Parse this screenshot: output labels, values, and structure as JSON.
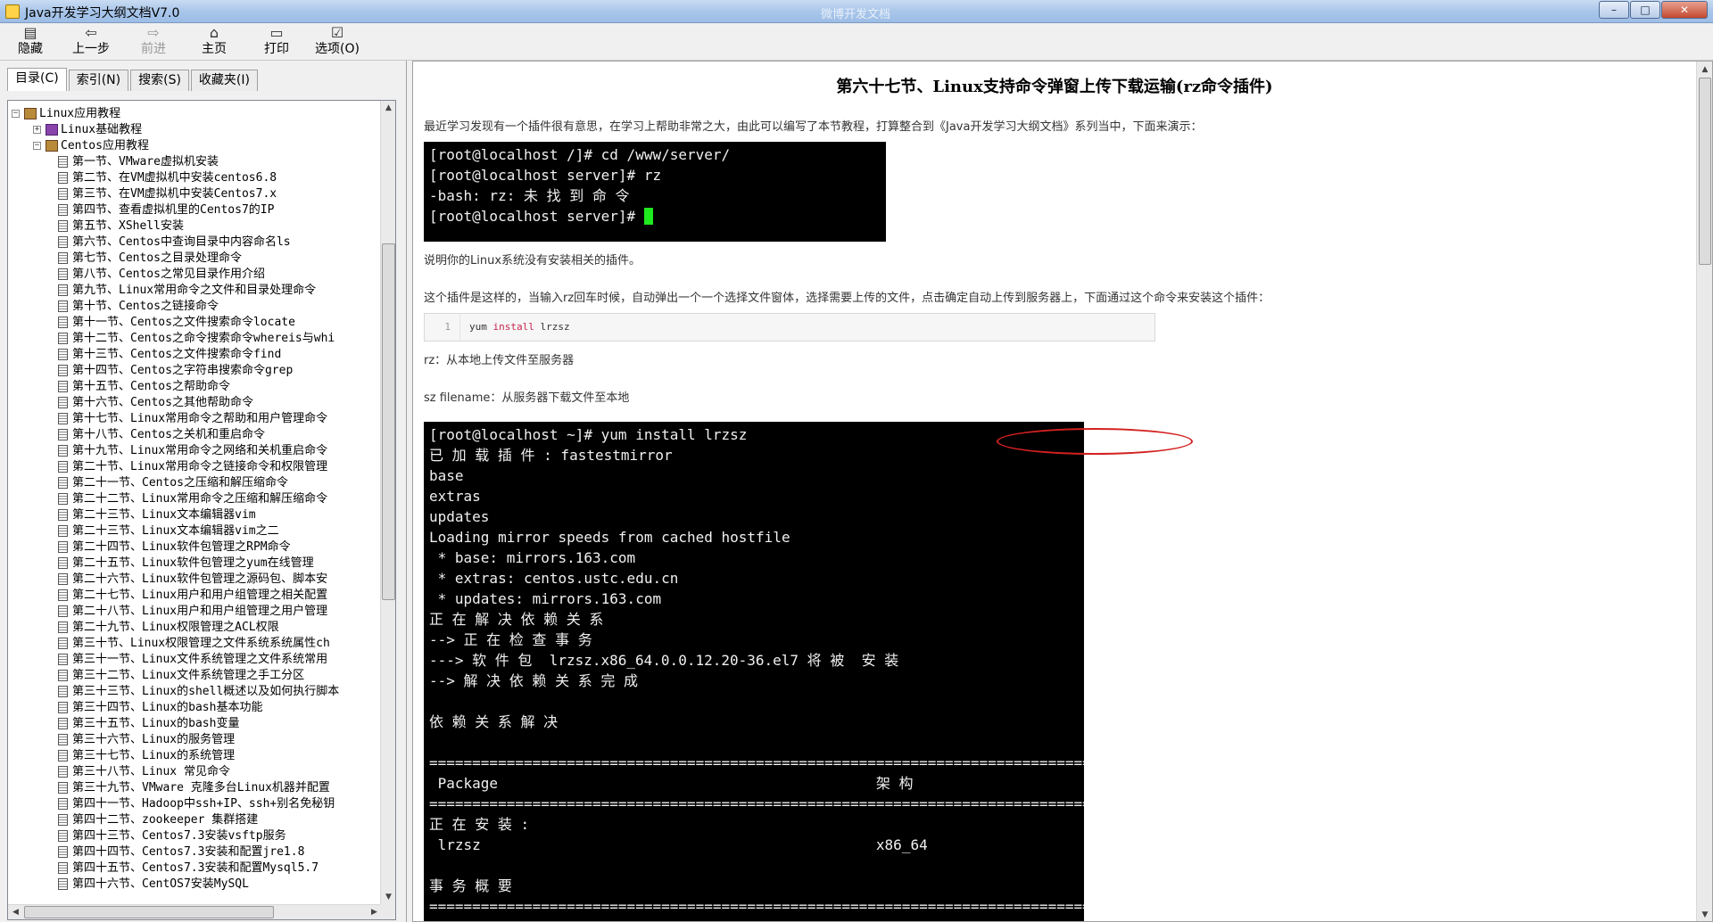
{
  "window": {
    "title": "Java开发学习大纲文档V7.0",
    "ghost_title": "微博开发文档",
    "minimize": "–",
    "maximize": "□",
    "close": "✕"
  },
  "toolbar": {
    "hide": "隐藏",
    "back": "上一步",
    "forward": "前进",
    "home": "主页",
    "print": "打印",
    "options": "选项(O)"
  },
  "tabs": [
    "目录(C)",
    "索引(N)",
    "搜索(S)",
    "收藏夹(I)"
  ],
  "tree": {
    "root": "Linux应用教程",
    "basics": "Linux基础教程",
    "centos": "Centos应用教程",
    "items": [
      "第一节、VMware虚拟机安装",
      "第二节、在VM虚拟机中安装centos6.8",
      "第三节、在VM虚拟机中安装Centos7.x",
      "第四节、查看虚拟机里的Centos7的IP",
      "第五节、XShell安装",
      "第六节、Centos中查询目录中内容命名ls",
      "第七节、Centos之目录处理命令",
      "第八节、Centos之常见目录作用介绍",
      "第九节、Linux常用命令之文件和目录处理命令",
      "第十节、Centos之链接命令",
      "第十一节、Centos之文件搜索命令locate",
      "第十二节、Centos之命令搜索命令whereis与whi",
      "第十三节、Centos之文件搜索命令find",
      "第十四节、Centos之字符串搜索命令grep",
      "第十五节、Centos之帮助命令",
      "第十六节、Centos之其他帮助命令",
      "第十七节、Linux常用命令之帮助和用户管理命令",
      "第十八节、Centos之关机和重启命令",
      "第十九节、Linux常用命令之网络和关机重启命令",
      "第二十节、Linux常用命令之链接命令和权限管理",
      "第二十一节、Centos之压缩和解压缩命令",
      "第二十二节、Linux常用命令之压缩和解压缩命令",
      "第二十三节、Linux文本编辑器vim",
      "第二十三节、Linux文本编辑器vim之二",
      "第二十四节、Linux软件包管理之RPM命令",
      "第二十五节、Linux软件包管理之yum在线管理",
      "第二十六节、Linux软件包管理之源码包、脚本安",
      "第二十七节、Linux用户和用户组管理之相关配置",
      "第二十八节、Linux用户和用户组管理之用户管理",
      "第二十九节、Linux权限管理之ACL权限",
      "第三十节、Linux权限管理之文件系统系统属性ch",
      "第三十一节、Linux文件系统管理之文件系统常用",
      "第三十二节、Linux文件系统管理之手工分区",
      "第三十三节、Linux的shell概述以及如何执行脚本",
      "第三十四节、Linux的bash基本功能",
      "第三十五节、Linux的bash变量",
      "第三十六节、Linux的服务管理",
      "第三十七节、Linux的系统管理",
      "第三十八节、Linux 常见命令",
      "第三十九节、VMware 克隆多台Linux机器并配置",
      "第四十一节、Hadoop中ssh+IP、ssh+别名免秘钥",
      "第四十二节、zookeeper 集群搭建",
      "第四十三节、Centos7.3安装vsftp服务",
      "第四十四节、Centos7.3安装和配置jre1.8",
      "第四十五节、Centos7.3安装和配置Mysql5.7",
      "第四十六节、CentOS7安装MySQL"
    ]
  },
  "content": {
    "title": "第六十七节、Linux支持命令弹窗上传下载运输(rz命令插件)",
    "intro": "最近学习发现有一个插件很有意思，在学习上帮助非常之大，由此可以编写了本节教程，打算整合到《Java开发学习大纲文档》系列当中，下面来演示：",
    "term1": {
      "l1": "[root@localhost /]# cd /www/server/",
      "l2": "[root@localhost server]# rz",
      "l3": "-bash: rz: 未 找 到 命 令",
      "l4": "[root@localhost server]# "
    },
    "note1": "说明你的Linux系统没有安装相关的插件。",
    "note2": "这个插件是这样的，当输入rz回车时候，自动弹出一个一个选择文件窗体，选择需要上传的文件，点击确定自动上传到服务器上，下面通过这个命令来安装这个插件：",
    "code": {
      "line_no": "1",
      "cmd": "yum",
      "kw": "install",
      "arg": "lrzsz"
    },
    "rz_desc": "rz：从本地上传文件至服务器",
    "sz_desc": "sz filename：从服务器下载文件至本地",
    "term2_text": "[root@localhost ~]# yum install lrzsz\n已 加 载 插 件 : fastestmirror\nbase\nextras\nupdates\nLoading mirror speeds from cached hostfile\n * base: mirrors.163.com\n * extras: centos.ustc.edu.cn\n * updates: mirrors.163.com\n正 在 解 决 依 赖 关 系\n--> 正 在 检 查 事 务\n---> 软 件 包  lrzsz.x86_64.0.0.12.20-36.el7 将 被  安 装\n--> 解 决 依 赖 关 系 完 成\n\n依 赖 关 系 解 决\n\n=========================================================================================\n Package                                            架 构\n=========================================================================================\n正 在 安 装 :\n lrzsz                                              x86_64\n\n事 务 概 要\n========================================================================================="
  }
}
